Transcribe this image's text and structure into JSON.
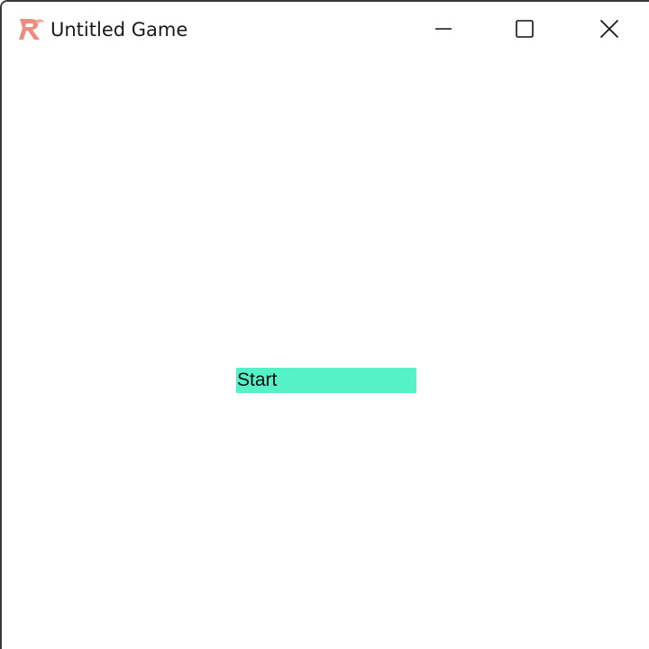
{
  "window": {
    "title": "Untitled Game",
    "app_icon": "ribbon-r-icon",
    "caption_buttons": [
      "minimize-icon",
      "maximize-icon",
      "close-icon"
    ]
  },
  "game": {
    "start_label": "Start"
  },
  "colors": {
    "start_button_bg": "#55f2c8",
    "app_icon": "#f08c7e",
    "window_bg": "#ffffff"
  }
}
